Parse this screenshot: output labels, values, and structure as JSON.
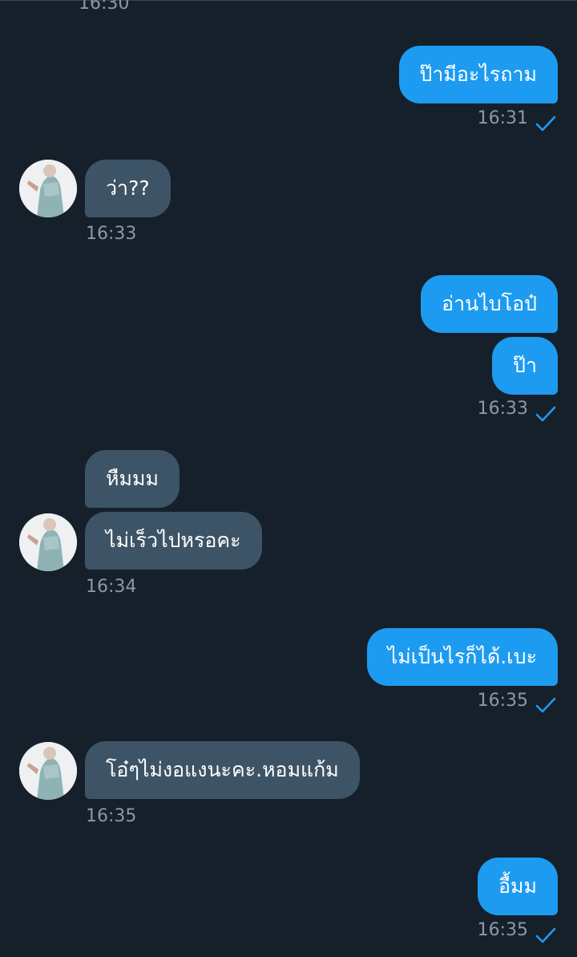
{
  "conversation": {
    "header_time_partial": "16:30",
    "messages": [
      {
        "id": "m1",
        "direction": "outgoing",
        "text": "ป๊ามีอะไรถาม",
        "time": "16:31",
        "status": "sent"
      },
      {
        "id": "m2",
        "direction": "incoming",
        "text": "ว่า??",
        "time": "16:33"
      },
      {
        "id": "m3",
        "direction": "outgoing",
        "text": "อ่านไบโอป๋",
        "time": ""
      },
      {
        "id": "m4",
        "direction": "outgoing",
        "text": "ป๊า",
        "time": "16:33",
        "status": "sent"
      },
      {
        "id": "m5",
        "direction": "incoming",
        "text": "หืมมม",
        "time": ""
      },
      {
        "id": "m6",
        "direction": "incoming",
        "text": "ไม่เร็วไปหรอคะ",
        "time": "16:34"
      },
      {
        "id": "m7",
        "direction": "outgoing",
        "text": "ไม่เป็นไรก็ได้.เบะ",
        "time": "16:35",
        "status": "sent"
      },
      {
        "id": "m8",
        "direction": "incoming",
        "text": "โอ๋ๆไม่งอแงนะคะ.หอมแก้ม",
        "time": "16:35"
      },
      {
        "id": "m9",
        "direction": "outgoing",
        "text": "อื้มม",
        "time": "16:35",
        "status": "sent"
      }
    ]
  },
  "colors": {
    "background": "#15202b",
    "outgoing_bubble": "#1d9bf0",
    "incoming_bubble": "#3d5466",
    "timestamp": "#8b98a5",
    "check": "#1d9bf0"
  },
  "icons": {
    "sent_status": "checkmark-icon",
    "avatar": "contact-avatar"
  }
}
